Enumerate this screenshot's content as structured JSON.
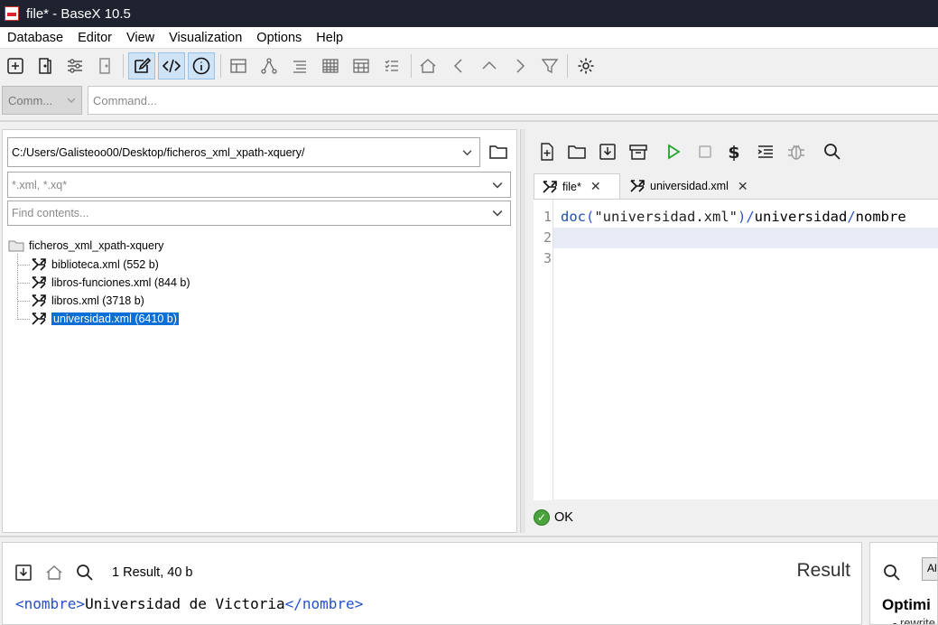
{
  "window": {
    "title": "file* - BaseX 10.5"
  },
  "menu": [
    "Database",
    "Editor",
    "View",
    "Visualization",
    "Options",
    "Help"
  ],
  "toolbar": {
    "buttons": [
      "new-database-icon",
      "open-database-icon",
      "properties-icon",
      "close-database-icon",
      "editor-icon",
      "xquery-icon",
      "info-icon",
      "map-icon",
      "tree-icon",
      "folder-view-icon",
      "table-icon",
      "scatterplot-icon",
      "explorer-icon",
      "home-icon",
      "back-icon",
      "up-icon",
      "forward-icon",
      "filter-icon",
      "settings-icon"
    ],
    "active": [
      "editor-icon",
      "xquery-icon",
      "info-icon"
    ]
  },
  "command": {
    "mode": "Comm...",
    "placeholder": "Command..."
  },
  "project": {
    "path": "C:/Users/Galisteoo00/Desktop/ficheros_xml_xpath-xquery/",
    "filter_placeholder": "*.xml, *.xq*",
    "find_placeholder": "Find contents...",
    "root": "ficheros_xml_xpath-xquery",
    "files": [
      {
        "label": "biblioteca.xml (552 b)",
        "selected": false
      },
      {
        "label": "libros-funciones.xml (844 b)",
        "selected": false
      },
      {
        "label": "libros.xml (3718 b)",
        "selected": false
      },
      {
        "label": "universidad.xml (6410 b)",
        "selected": true
      }
    ]
  },
  "editor": {
    "tabs": [
      {
        "label": "file*",
        "active": true
      },
      {
        "label": "universidad.xml",
        "active": false
      }
    ],
    "line_numbers": [
      "1",
      "2",
      "3"
    ],
    "code": {
      "fn": "doc",
      "open_paren": "(",
      "string": "\"universidad.xml\"",
      "close_paren": ")",
      "slash1": "/",
      "step1": "universidad",
      "slash2": "/",
      "step2": "nombre"
    },
    "status": "OK"
  },
  "result": {
    "count": "1 Result, 40 b",
    "title": "Result",
    "open_tag": "<nombre>",
    "text": "Universidad de Victoria",
    "close_tag": "</nombre>"
  },
  "info": {
    "filter": "All",
    "title": "Optimi",
    "subtitle": "- rewrite"
  }
}
